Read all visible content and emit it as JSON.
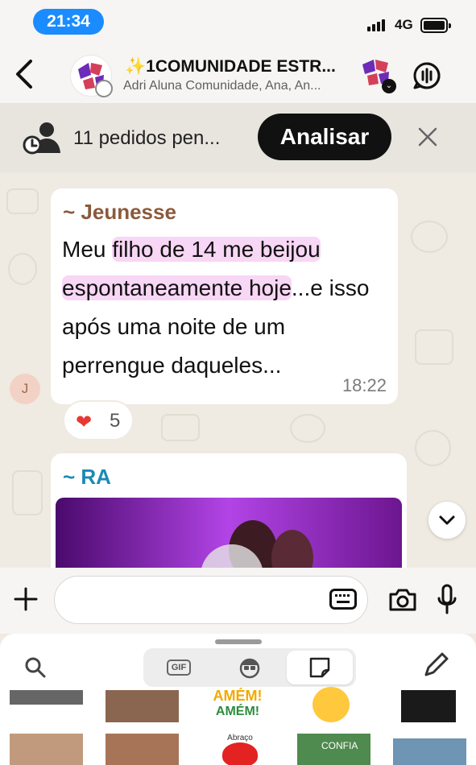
{
  "status": {
    "time": "21:34",
    "network": "4G"
  },
  "header": {
    "title": "✨1COMUNIDADE ESTR...",
    "subtitle": "Adri Aluna Comunidade, Ana, An..."
  },
  "pending": {
    "text": "11 pedidos pen...",
    "button": "Analisar"
  },
  "messages": [
    {
      "sender": "~ Jeunesse",
      "text_highlighted_1": "filho de 14 me beijou",
      "text_highlighted_2": "espontaneamente hoje",
      "text_part_1": "Meu ",
      "text_part_2": "...e isso após uma noite de um perrengue daqueles...",
      "time": "18:22",
      "avatar_initial": "J",
      "reaction_emoji": "❤",
      "reaction_count": "5"
    },
    {
      "sender": "~ RA"
    }
  ],
  "composer": {
    "input_value": "",
    "input_placeholder": ""
  },
  "panel": {
    "tab_gif": "GIF",
    "sticker_text_amem_1": "AMÉM!",
    "sticker_text_amem_2": "AMÉM!",
    "sticker_text_abraco": "Abraço",
    "sticker_text_confia": "CONFIA"
  },
  "colors": {
    "accent": "#1a8cff",
    "highlight": "#f8d6f5",
    "sender_jeunesse": "#8b5a3c",
    "sender_ra": "#1a8ab5"
  }
}
